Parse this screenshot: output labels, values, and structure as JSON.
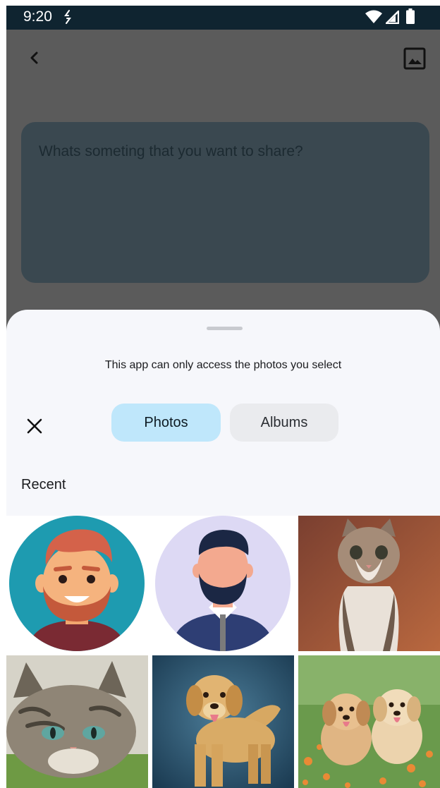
{
  "status_bar": {
    "time": "9:20",
    "icons": [
      "sync-icon",
      "wifi-icon",
      "signal-icon",
      "battery-icon"
    ]
  },
  "app_bar": {
    "back_icon": "back-arrow-icon",
    "image_icon": "image-icon"
  },
  "compose": {
    "placeholder": "Whats someting that you want to share?"
  },
  "picker": {
    "access_note": "This app can only access the photos you select",
    "close_icon": "close-icon",
    "tabs": [
      {
        "label": "Photos",
        "selected": true
      },
      {
        "label": "Albums",
        "selected": false
      }
    ],
    "section_title": "Recent",
    "photos": [
      {
        "subject": "avatar-red-hair-man"
      },
      {
        "subject": "avatar-bearded-man-blue-shirt"
      },
      {
        "subject": "kitten-sitting"
      },
      {
        "subject": "tabby-cat-lying"
      },
      {
        "subject": "golden-retriever-standing"
      },
      {
        "subject": "two-puppies-flowers"
      }
    ]
  },
  "colors": {
    "status_bar": "#0f2430",
    "scrim": "#5b5b5b",
    "compose_box": "#3a4850",
    "sheet": "#f6f7fb",
    "tab_selected": "#bfe7fb",
    "tab_unselected": "#eaebee"
  }
}
